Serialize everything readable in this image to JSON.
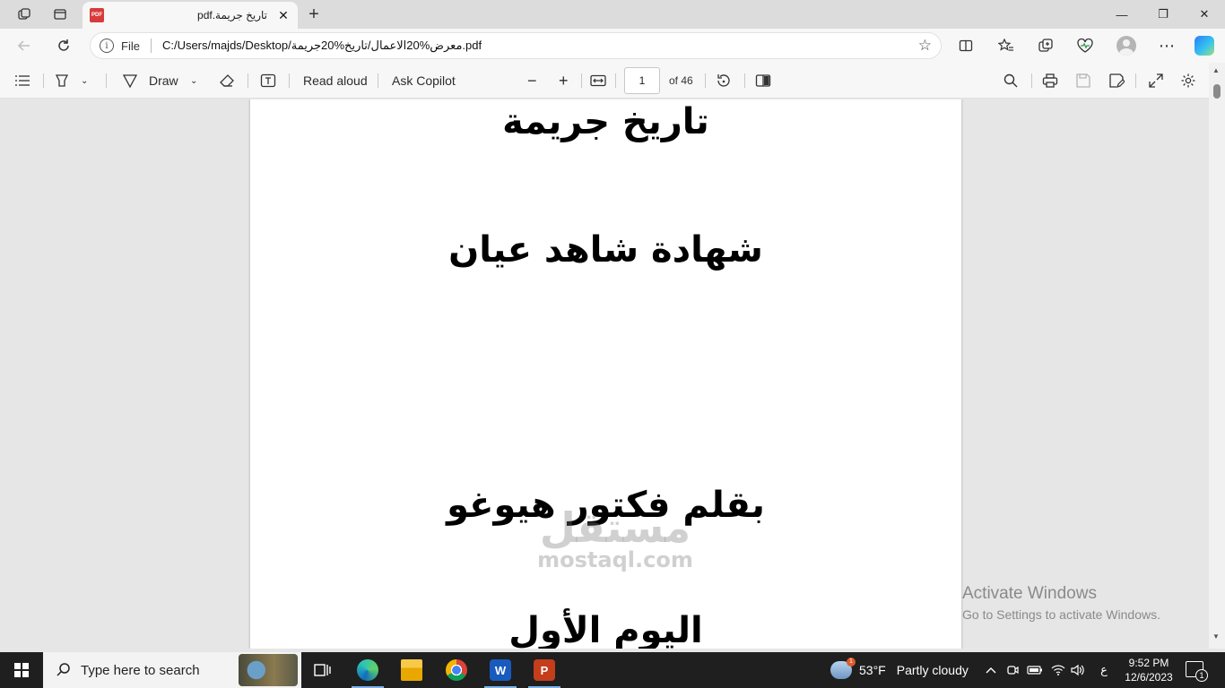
{
  "browser": {
    "tab": {
      "title": "pdf.تاريخ جريمة",
      "icon": "pdf-file-icon"
    },
    "window_controls": {
      "minimize": "—",
      "restore": "❐",
      "close": "✕"
    },
    "address": {
      "scheme_label": "File",
      "url": "C:/Users/majds/Desktop/معرض%20الاعمال/تاريخ%20جريمة.pdf"
    }
  },
  "pdf_toolbar": {
    "draw_label": "Draw",
    "read_aloud_label": "Read aloud",
    "ask_copilot_label": "Ask Copilot",
    "page_number": "1",
    "page_count_label": "of 46"
  },
  "document": {
    "line1": "تاريخ جريمة",
    "line2": "شهادة شاهد عيان",
    "line3": "بقلم فكتور هيوغو",
    "line4": "اليوم الأول"
  },
  "watermark": {
    "arabic": "مستقل",
    "latin": "mostaql.com"
  },
  "activation": {
    "title": "Activate Windows",
    "subtitle": "Go to Settings to activate Windows."
  },
  "taskbar": {
    "search_placeholder": "Type here to search",
    "weather": {
      "temp": "53°F",
      "condition": "Partly cloudy"
    },
    "ime": "ع",
    "time": "9:52 PM",
    "date": "12/6/2023",
    "notification_count": "1"
  },
  "colors": {
    "edge_accent": "#0f6cbd",
    "word_blue": "#185abd",
    "powerpoint_red": "#c43e1c",
    "chrome_red": "#db4437"
  }
}
